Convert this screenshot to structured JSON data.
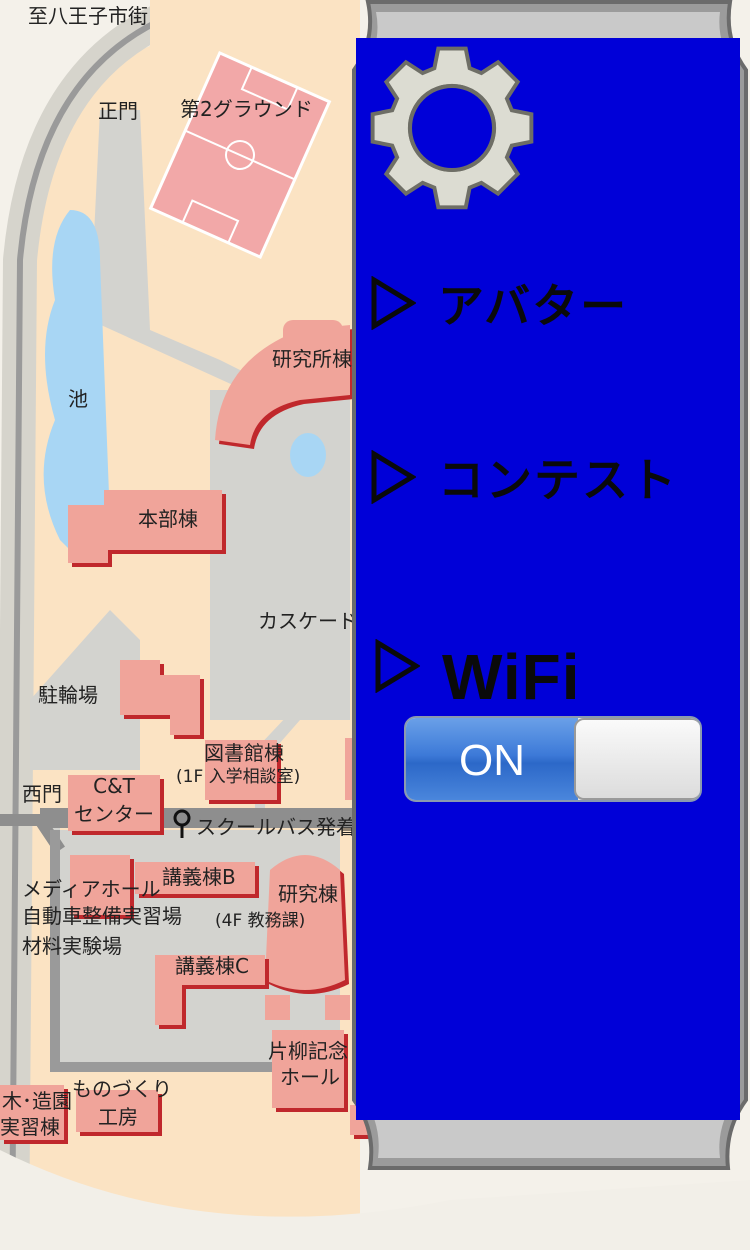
{
  "map": {
    "labels": {
      "hachioji": "至八王子市街",
      "main_gate": "正門",
      "ground2": "第2グラウンド",
      "pond": "池",
      "lab_building": "研究所棟",
      "main_building": "本部棟",
      "cascade": "カスケード",
      "bike_parking": "駐輪場",
      "library": "図書館棟",
      "library_sub": "(1F 入学相談室)",
      "west_gate": "西門",
      "ct_center_1": "C&T",
      "ct_center_2": "センター",
      "school_bus": "スクールバス発着",
      "lecture_b": "講義棟B",
      "research": "研究棟",
      "research_sub": "(4F 教務課)",
      "media_hall_1": "メディアホール",
      "media_hall_2": "自動車整備実習場",
      "media_hall_3": "材料実験場",
      "lecture_c": "講義棟C",
      "katayanagi_1": "片柳記念",
      "katayanagi_2": "ホール",
      "monozukuri_1": "ものづくり",
      "monozukuri_2": "工房",
      "woodwork_1": "木･造園",
      "woodwork_2": "実習棟"
    }
  },
  "panel": {
    "settings_icon": "gear-icon",
    "menu": [
      {
        "label": "アバター",
        "icon": "play-arrow-icon"
      },
      {
        "label": "コンテスト",
        "icon": "play-arrow-icon"
      },
      {
        "label": "WiFi",
        "icon": "play-arrow-icon"
      }
    ],
    "wifi_toggle": {
      "label": "ON",
      "state": "on"
    }
  },
  "colors": {
    "panel_blue": "#0000d8",
    "building_pink": "#f0a49a",
    "building_shadow": "#c0282c",
    "campus_beige": "#fbe3c3",
    "road_gray": "#d3d3cf",
    "pond_blue": "#a8d6f4",
    "toggle_blue": "#3d7ad8"
  }
}
